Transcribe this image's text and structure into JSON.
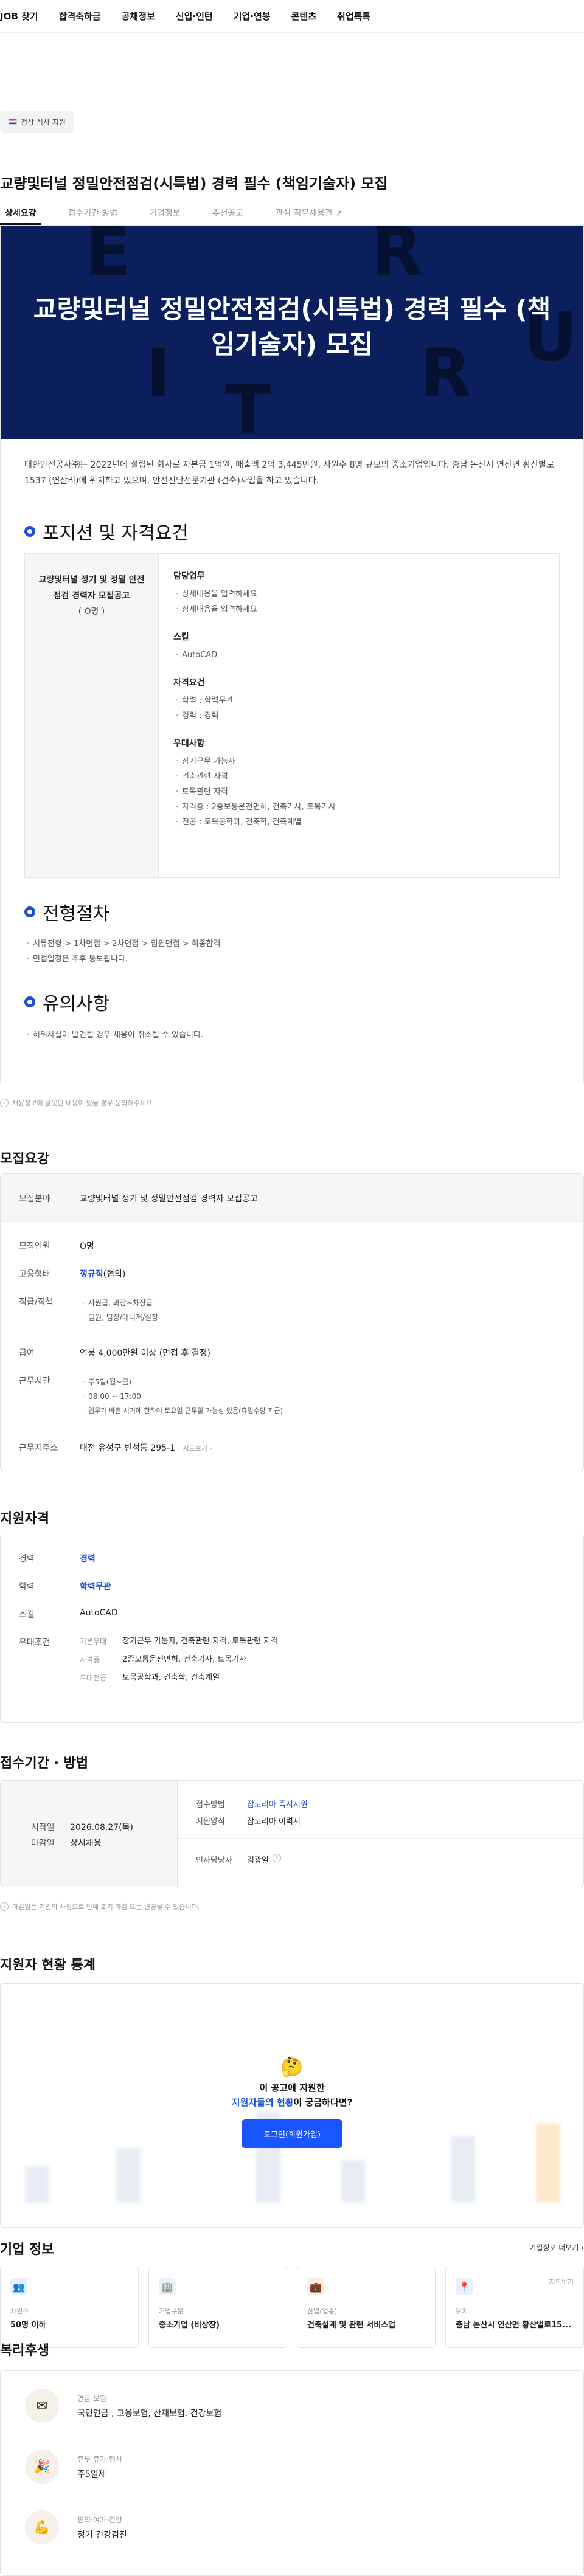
{
  "nav": [
    "JOB 찾기",
    "합격축하금",
    "공채정보",
    "신입·인턴",
    "기업·연봉",
    "콘텐츠",
    "취업톡톡"
  ],
  "scrap_label": "정상 식사 지원",
  "title": "교량및터널 정밀안전점검(시특법) 경력 필수 (책임기술자) 모집",
  "tabs": [
    "상세요강",
    "접수기간·방법",
    "기업정보",
    "추천공고",
    "관심 직무채용관"
  ],
  "hero": {
    "bg_letters": [
      "E",
      "R",
      "I",
      "T",
      "R",
      "U"
    ],
    "title": "교량및터널 정밀안전점검(시특법) 경력 필수 (책임기술자) 모집"
  },
  "intro": "대한안전공사㈜는 2022년에 설립된 회사로 자본금 1억원, 매출액 2억 3,445만원, 사원수 8명 규모의 중소기업입니다. 충남 논산시 연산면 황산벌로 1537 (연산리)에 위치하고 있으며, 안전진단전문기관 (건축)사업을 하고 있습니다.",
  "sections": {
    "position": "포지션 및 자격요건",
    "process": "전형절차",
    "caution": "유의사항"
  },
  "position_box": {
    "left_title": "교량및터널 정기 및 정밀 안전점검 경력자 모집공고",
    "left_count": "( O명 )",
    "groups": [
      {
        "title": "담당업무",
        "lines": [
          "상세내용을 입력하세요",
          "상세내용을 입력하세요"
        ]
      },
      {
        "title": "스킬",
        "lines": [
          "AutoCAD"
        ]
      },
      {
        "title": "자격요건",
        "lines": [
          "학력 : 학력무관",
          "경력 : 경력"
        ]
      },
      {
        "title": "우대사항",
        "lines": [
          "장기근무 가능자",
          "건축관련 자격",
          "토목관련 자격",
          "자격증 : 2종보통운전면허, 건축기사, 토목기사",
          "전공 : 토목공학과, 건축학, 건축계열"
        ]
      }
    ]
  },
  "process_text": [
    "서류전형 > 1차면접 > 2차면접 > 임원면접 > 최종합격",
    "면접일정은 추후 통보됩니다."
  ],
  "caution_text": "허위사실이 발견될 경우 채용이 취소될 수 있습니다.",
  "notice_small": "채용정보에 잘못된 내용이 있을 경우 문의해주세요.",
  "recruit": {
    "heading": "모집요강",
    "rows": {
      "field_k": "모집분야",
      "field_v": "교량및터널 정기 및 정밀안전점검 경력자 모집공고",
      "count_k": "모집인원",
      "count_v": "O명",
      "type_k": "고용형태",
      "type_v": "정규직",
      "type_extra": "(협의)",
      "rank_k": "직급/직책",
      "rank_lines": [
        "사원급, 과장~차장급",
        "팀원, 팀장/매니저/실장"
      ],
      "pay_k": "급여",
      "pay_v": "연봉 4,000만원 이상 (면접 후 결정)",
      "hours_k": "근무시간",
      "hours_lines": [
        "주5일(월~금)",
        "08:00 ~ 17:00",
        "업무가 바쁜 시기에 한하여 토요일 근무할 가능성 있음(휴일수당 지급)"
      ],
      "addr_k": "근무지주소",
      "addr_v": "대전 유성구 반석동 295-1",
      "addr_link": "지도보기"
    }
  },
  "qualify": {
    "heading": "지원자격",
    "career_k": "경력",
    "career_v": "경력",
    "edu_k": "학력",
    "edu_v": "학력무관",
    "skill_k": "스킬",
    "skill_v": "AutoCAD",
    "pref_k": "우대조건",
    "pref_rows": [
      {
        "k": "기본우대",
        "v": "장기근무 가능자, 건축관련 자격, 토목관련 자격"
      },
      {
        "k": "자격증",
        "v": "2종보통운전면허, 건축기사, 토목기사"
      },
      {
        "k": "우대전공",
        "v": "토목공학과, 건축학, 건축계열"
      }
    ]
  },
  "apply": {
    "heading": "접수기간 · 방법",
    "start_k": "시작일",
    "start_v": "2026.08.27(목)",
    "end_k": "마감일",
    "end_v": "상시채용",
    "method_k": "접수방법",
    "method_v": "잡코리아 즉시지원",
    "form_k": "지원양식",
    "form_v": "잡코리아 이력서",
    "manager_k": "인사담당자",
    "manager_v": "김광일",
    "note": "마감일은 기업의 사정으로 인해 조기 마감 또는 변경될 수 있습니다."
  },
  "stats": {
    "heading": "지원자 현황 통계",
    "msg1": "이 공고에 지원한",
    "msg2_blue": "지원자들의 현황",
    "msg2_rest": "이 궁금하다면?",
    "login": "로그인(회원가입)"
  },
  "company": {
    "heading": "기업 정보",
    "more": "기업정보 더보기",
    "cards": [
      {
        "label": "사원수",
        "value": "50명 이하"
      },
      {
        "label": "기업구분",
        "value": "중소기업 (비상장)"
      },
      {
        "label": "산업(업종)",
        "value": "건축설계 및 관련 서비스업"
      },
      {
        "label": "위치",
        "value": "충남 논산시 연산면 황산벌로15...",
        "link": "지도보기"
      }
    ]
  },
  "welfare": {
    "heading": "복리후생",
    "items": [
      {
        "cat": "연금·보험",
        "val": "국민연금 , 고용보험, 산재보험, 건강보험"
      },
      {
        "cat": "휴무·휴가·행사",
        "val": "주5일제"
      },
      {
        "cat": "편의·여가·건강",
        "val": "정기 건강검진"
      }
    ]
  },
  "colors": {
    "accent": "#1d4ed8",
    "hero_bg": "#0b1f5c",
    "login_btn": "#1a56ff"
  }
}
